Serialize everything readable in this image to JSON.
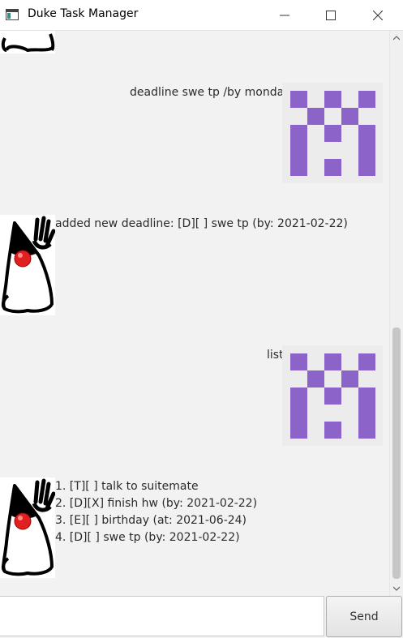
{
  "window": {
    "title": "Duke Task Manager"
  },
  "colors": {
    "avatar_purple": "#8c63c9"
  },
  "messages": [
    {
      "from": "user",
      "text": "deadline swe tp /by monday"
    },
    {
      "from": "duke",
      "text": "added new deadline: [D][ ] swe tp (by: 2021-02-22)"
    },
    {
      "from": "user",
      "text": "list"
    },
    {
      "from": "duke",
      "lines": [
        "1. [T][ ] talk to suitemate",
        "2. [D][X] finish hw (by: 2021-02-22)",
        "3. [E][ ] birthday (at: 2021-06-24)",
        "4. [D][ ] swe tp (by: 2021-02-22)"
      ]
    }
  ],
  "input": {
    "value": "",
    "placeholder": ""
  },
  "send_button": {
    "label": "Send"
  },
  "icons": {
    "app": "app-window-icon",
    "minimize": "minimize-icon",
    "maximize": "maximize-icon",
    "close": "close-icon",
    "duke": "duke-mascot-icon",
    "user": "purple-identicon-avatar"
  }
}
